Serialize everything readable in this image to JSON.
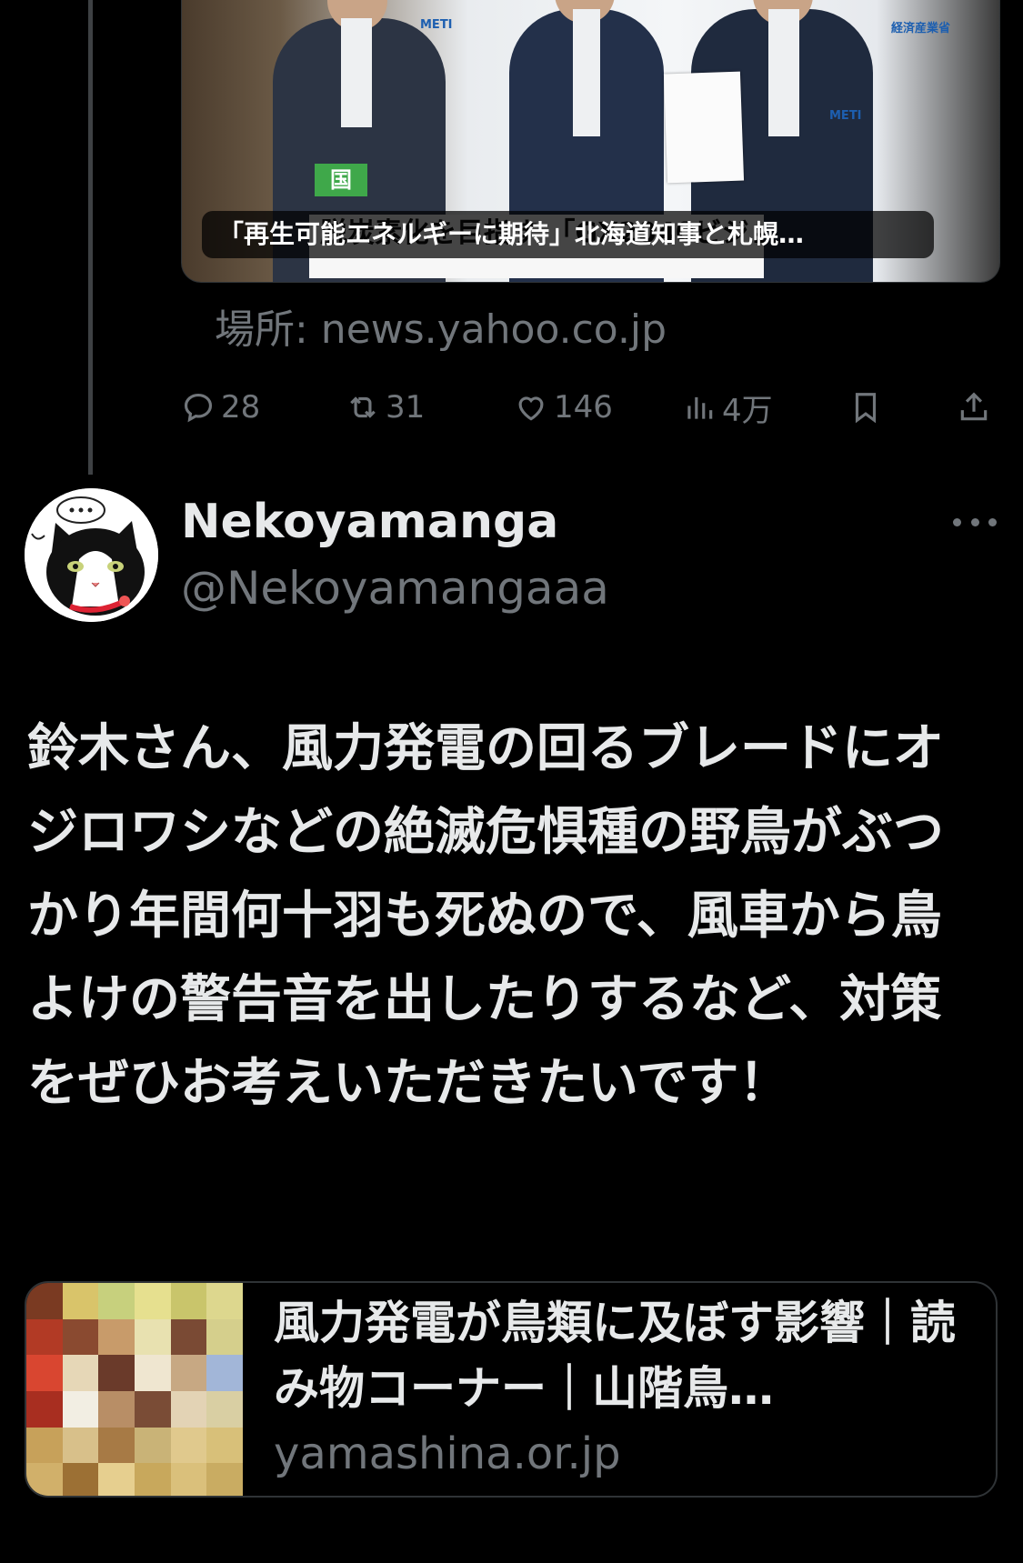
{
  "top_card": {
    "badge": "国",
    "tv_caption": "脱炭素化を目指す\n「GX2040ビジョン」の策定を進める",
    "logo_meti": "METI",
    "logo_ministry": "経済産業省",
    "title": "「再生可能エネルギーに期待」北海道知事と札幌…",
    "source": "場所: news.yahoo.co.jp"
  },
  "actions": {
    "replies": "28",
    "reposts": "31",
    "likes": "146",
    "views": "4万"
  },
  "tweet": {
    "display_name": "Nekoyamanga",
    "handle": "@Nekoyamangaaa",
    "text": "鈴木さん、風力発電の回るブレードにオジロワシなどの絶滅危惧種の野鳥がぶつかり年間何十羽も死ぬので、風車から鳥よけの警告音を出したりするなど、対策をぜひお考えいただきたいです！",
    "link_card": {
      "title": "風力発電が鳥類に及ぼす影響｜読み物コーナー｜山階鳥…",
      "domain": "yamashina.or.jp"
    }
  },
  "colors": {
    "background": "#000000",
    "text": "#e7e9ea",
    "secondary": "#71767b",
    "border": "#2f3336"
  }
}
